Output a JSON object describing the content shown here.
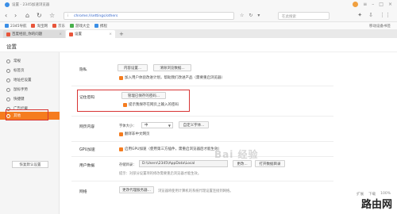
{
  "window": {
    "title": "设置 - 2345加速浏览器"
  },
  "toolbar": {
    "url": "chrome://settings/others",
    "url_info": "i",
    "search_placeholder": "在此搜索",
    "back": "‹",
    "forward": "›",
    "reload": "↻",
    "home": "⌂"
  },
  "bookmarks": {
    "items": [
      {
        "label": "2345导航",
        "color": "#3a8ee6"
      },
      {
        "label": "淘宝网",
        "color": "#e8553a"
      },
      {
        "label": "京东",
        "color": "#e8553a"
      },
      {
        "label": "游戏大全",
        "color": "#48b04c"
      },
      {
        "label": "携程",
        "color": "#3a8ee6"
      }
    ],
    "right_label": "移动设备书签"
  },
  "tabs": {
    "inactive": "百度经验_你的问题",
    "active": "设置",
    "add": "+"
  },
  "page": {
    "title": "设置"
  },
  "sidebar": {
    "items": [
      {
        "label": "常规"
      },
      {
        "label": "标签页"
      },
      {
        "label": "地址栏设置"
      },
      {
        "label": "鼠标手势"
      },
      {
        "label": "快捷键"
      },
      {
        "label": "广告拦截"
      },
      {
        "label": "其他"
      }
    ],
    "active_index": 6,
    "restore_button": "恢复默认设置"
  },
  "sections": {
    "privacy": {
      "label": "隐私",
      "btn_content": "内容设置...",
      "btn_clear": "清除浏览数据...",
      "check_label": "加入用户体验改进计划，帮助我们改进产品（需要重启浏览器）"
    },
    "password": {
      "label": "记住密码",
      "btn_manage": "管理已保存的密码...",
      "check_label": "提示我保存在网页上输入的密码"
    },
    "content": {
      "label": "网页内容",
      "font_size_label": "字体大小：",
      "font_size_value": "中",
      "btn_font": "自定义字体...",
      "check_label": "翻译非中文网页"
    },
    "gpu": {
      "label": "GPU加速",
      "check_label": "启用GPU加速（使用第三方插件，需重启浏览器后才能生效）"
    },
    "userdata": {
      "label": "用户数据",
      "path_label": "存储目录：",
      "path_value": "D:\\Users\\2345\\AppData\\Local",
      "btn_change": "更改...",
      "btn_open": "打开数据目录",
      "hint": "提示：对部分设置项的修改需要重启浏览器才能生效。"
    },
    "network": {
      "label": "网络",
      "btn_proxy": "更改代理服务器...",
      "hint": "浏览器将使用计算机的系统代理设置连接到网络。"
    }
  },
  "status": {
    "items": [
      "扩展",
      "下载",
      "100%"
    ]
  },
  "watermark": "Bai 经验",
  "corner_logo": "路由网",
  "colors": {
    "accent": "#f57c1f",
    "highlight": "#d73434",
    "link": "#3366cc"
  }
}
